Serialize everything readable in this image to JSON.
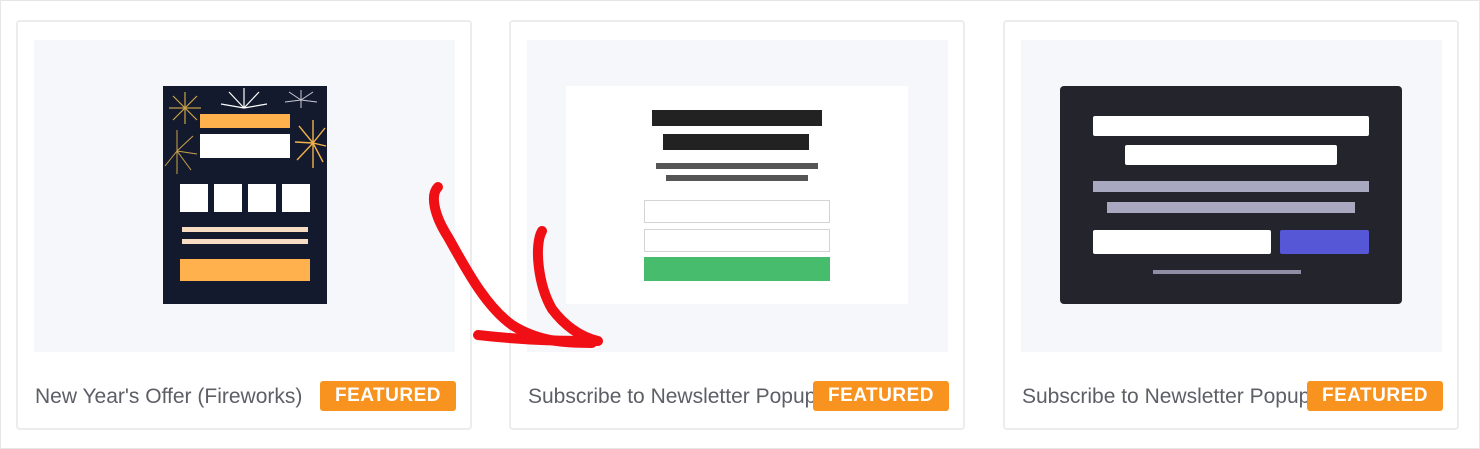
{
  "templates": [
    {
      "title": "New Year's Offer (Fireworks)",
      "badge": "FEATURED"
    },
    {
      "title": "Subscribe to Newsletter Popup",
      "badge": "FEATURED"
    },
    {
      "title": "Subscribe to Newsletter Popup",
      "badge": "FEATURED"
    }
  ],
  "colors": {
    "badge": "#f7931e",
    "arrow": "#f10f16",
    "fireworks_bg": "#141a2e",
    "fireworks_accent": "#ffb14e",
    "green_button": "#46bc6c",
    "dark_bg": "#24242c",
    "purple_button": "#5657d6"
  },
  "icons": [
    "fireworks-icon",
    "curved-arrow-icon"
  ]
}
